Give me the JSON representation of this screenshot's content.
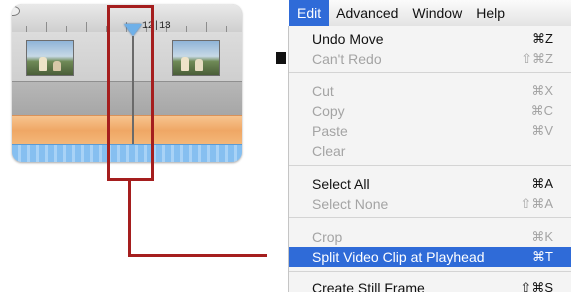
{
  "timeline": {
    "playhead_time": "12|13"
  },
  "menubar": {
    "items": [
      "Edit",
      "Advanced",
      "Window",
      "Help"
    ],
    "active": "Edit"
  },
  "edit_menu": {
    "items": [
      {
        "label": "Undo Move",
        "shortcut": "⌘Z",
        "enabled": true
      },
      {
        "label": "Can't Redo",
        "shortcut": "⇧⌘Z",
        "enabled": false
      },
      {
        "label": "Cut",
        "shortcut": "⌘X",
        "enabled": false
      },
      {
        "label": "Copy",
        "shortcut": "⌘C",
        "enabled": false
      },
      {
        "label": "Paste",
        "shortcut": "⌘V",
        "enabled": false
      },
      {
        "label": "Clear",
        "shortcut": "",
        "enabled": false
      },
      {
        "label": "Select All",
        "shortcut": "⌘A",
        "enabled": true
      },
      {
        "label": "Select None",
        "shortcut": "⇧⌘A",
        "enabled": false
      },
      {
        "label": "Crop",
        "shortcut": "⌘K",
        "enabled": false
      },
      {
        "label": "Split Video Clip at Playhead",
        "shortcut": "⌘T",
        "enabled": true,
        "highlighted": true
      },
      {
        "label": "Create Still Frame",
        "shortcut": "⇧⌘S",
        "enabled": true
      }
    ]
  },
  "colors": {
    "highlight": "#a51e1e",
    "menu_selection": "#2f6bd8"
  }
}
